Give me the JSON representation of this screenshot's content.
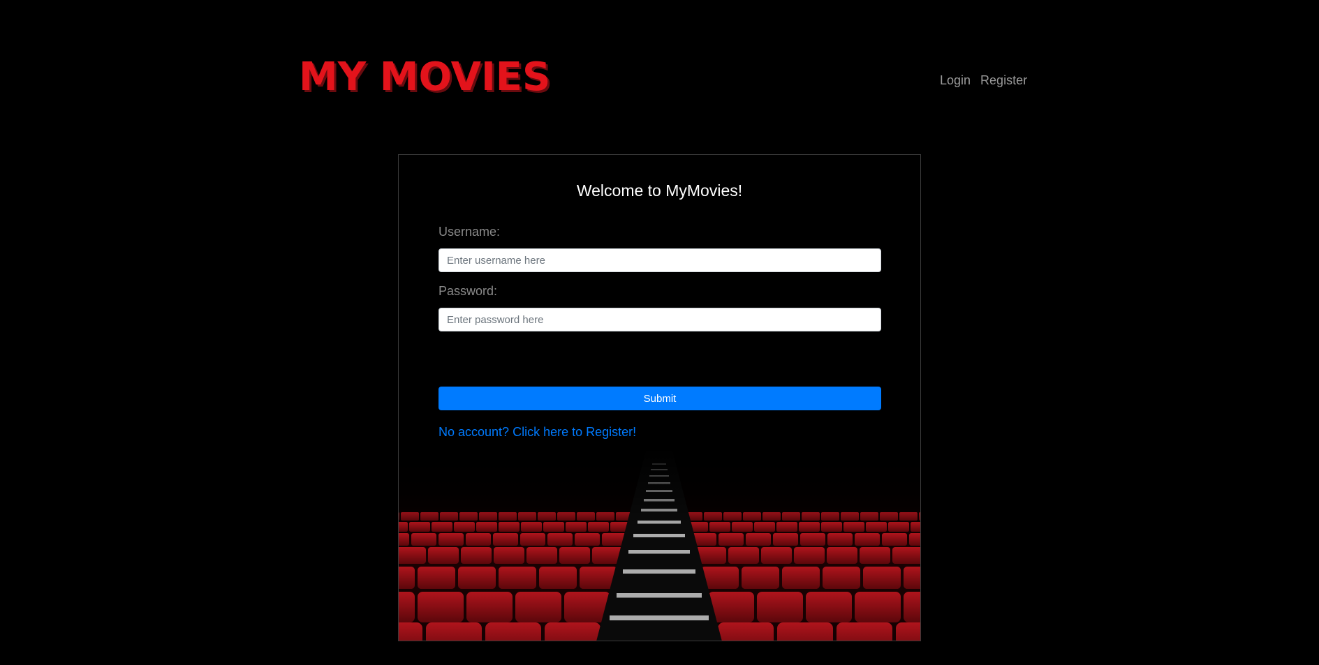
{
  "header": {
    "logo": "MY MOVIES",
    "nav": {
      "login": "Login",
      "register": "Register"
    }
  },
  "login_form": {
    "title": "Welcome to MyMovies!",
    "username_label": "Username:",
    "username_placeholder": "Enter username here",
    "username_value": "",
    "password_label": "Password:",
    "password_placeholder": "Enter password here",
    "password_value": "",
    "submit_label": "Submit",
    "register_link": "No account? Click here to Register!"
  },
  "colors": {
    "brand": "#e3131b",
    "primary": "#007bff",
    "background": "#000000"
  }
}
